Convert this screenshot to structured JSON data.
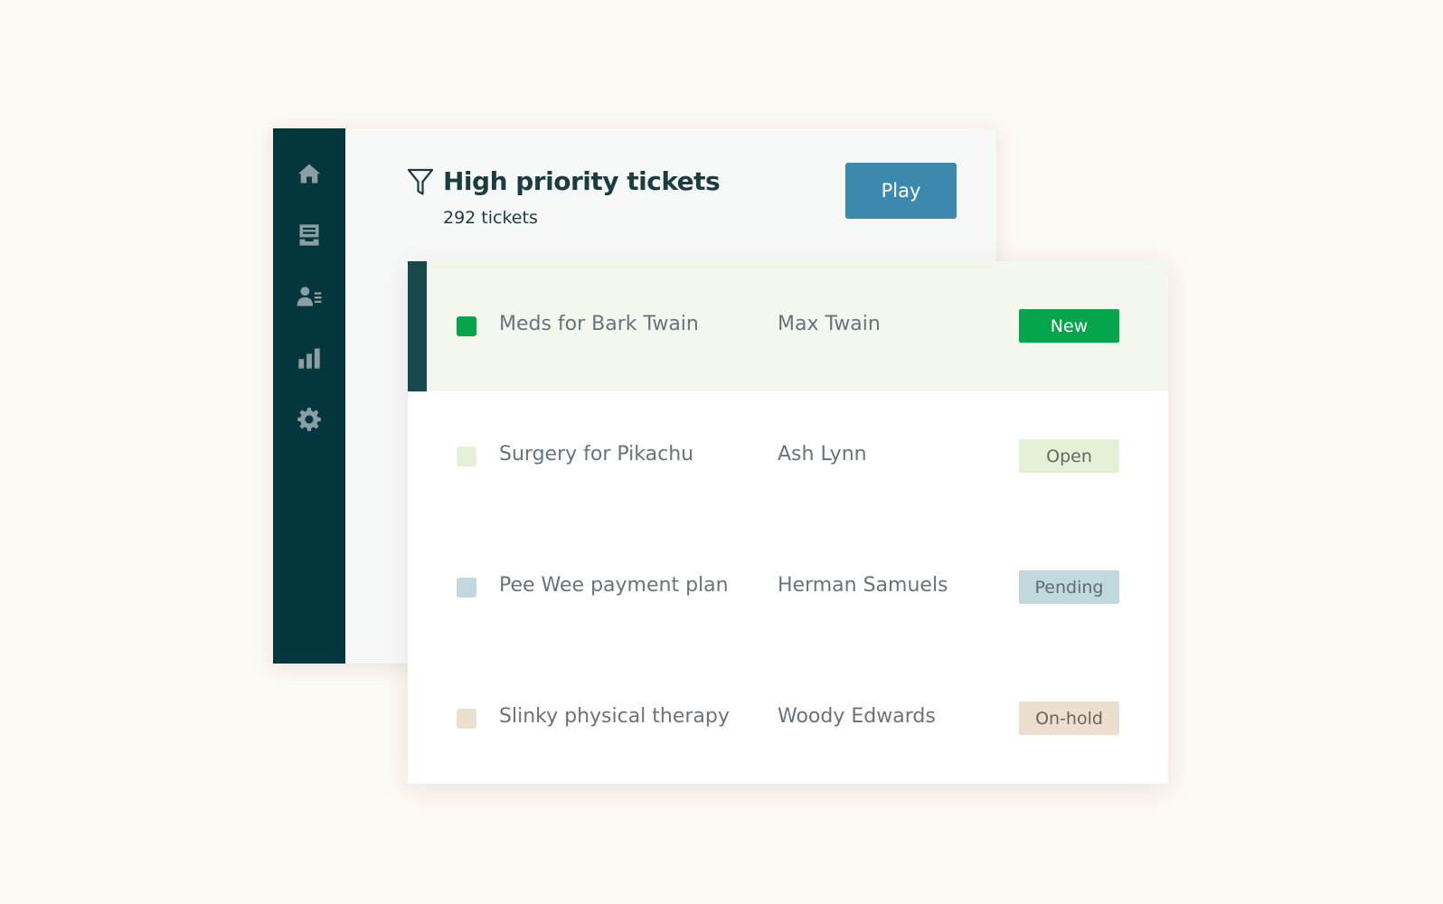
{
  "header": {
    "title": "High priority tickets",
    "count": "292 tickets",
    "play_label": "Play"
  },
  "sidebar": {
    "items": [
      {
        "icon": "home-icon"
      },
      {
        "icon": "inbox-icon"
      },
      {
        "icon": "customers-icon"
      },
      {
        "icon": "reporting-icon"
      },
      {
        "icon": "settings-icon"
      }
    ]
  },
  "tickets": [
    {
      "subject": "Meds for Bark Twain",
      "requester": "Max Twain",
      "status": "New",
      "selected": true
    },
    {
      "subject": "Surgery for Pikachu",
      "requester": "Ash Lynn",
      "status": "Open",
      "selected": false
    },
    {
      "subject": "Pee Wee payment plan",
      "requester": "Herman Samuels",
      "status": "Pending",
      "selected": false
    },
    {
      "subject": "Slinky physical therapy",
      "requester": "Woody Edwards",
      "status": "On-hold",
      "selected": false
    }
  ],
  "colors": {
    "sidebar": "#03363d",
    "play_button": "#3d89ad",
    "new": "#05a54b",
    "open": "#e5f0d7",
    "pending": "#c1d8dc",
    "on_hold": "#ecdfcf"
  }
}
